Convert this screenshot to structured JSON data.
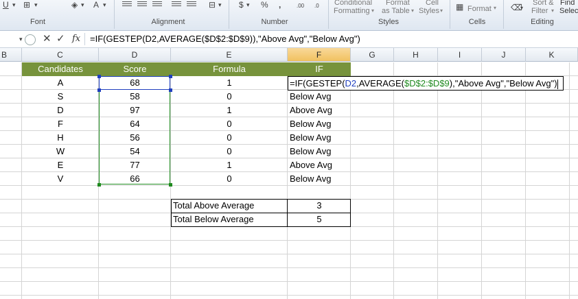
{
  "ribbon": {
    "groups": [
      "Font",
      "Alignment",
      "Number",
      "Styles",
      "Cells",
      "Editing"
    ],
    "font_underline": "U",
    "font_fill_icon": "fill-color-icon",
    "font_color_letter": "A",
    "number_currency": "$",
    "number_percent": "%",
    "number_comma": ",",
    "number_inc_decimal": ".00",
    "number_dec_decimal": ".0",
    "styles_conditional": [
      "Conditional",
      "Formatting"
    ],
    "styles_format_table": [
      "Format",
      "as Table"
    ],
    "styles_cell": [
      "Cell",
      "Styles"
    ],
    "cells_format": "Format",
    "editing_sort": [
      "Sort &",
      "Filter"
    ],
    "editing_find": [
      "Find",
      "Selec"
    ]
  },
  "formula_bar": {
    "fx": "fx",
    "formula": "=IF(GESTEP(D2,AVERAGE($D$2:$D$9)),\"Above Avg\",\"Below Avg\")"
  },
  "columns": [
    "B",
    "C",
    "D",
    "E",
    "F",
    "G",
    "H",
    "I",
    "J",
    "K"
  ],
  "table": {
    "headers": {
      "candidates": "Candidates",
      "score": "Score",
      "formula": "Formula",
      "if": "IF"
    },
    "rows": [
      {
        "candidate": "A",
        "score": "68",
        "formula": "1",
        "if": ""
      },
      {
        "candidate": "S",
        "score": "58",
        "formula": "0",
        "if": "Below Avg"
      },
      {
        "candidate": "D",
        "score": "97",
        "formula": "1",
        "if": "Above Avg"
      },
      {
        "candidate": "F",
        "score": "64",
        "formula": "0",
        "if": "Below Avg"
      },
      {
        "candidate": "H",
        "score": "56",
        "formula": "0",
        "if": "Below Avg"
      },
      {
        "candidate": "W",
        "score": "54",
        "formula": "0",
        "if": "Below Avg"
      },
      {
        "candidate": "E",
        "score": "77",
        "formula": "1",
        "if": "Above Avg"
      },
      {
        "candidate": "V",
        "score": "66",
        "formula": "0",
        "if": "Below Avg"
      }
    ]
  },
  "editing_cell": {
    "part1": "=IF(GESTEP(",
    "ref1": "D2",
    "part2": ",AVERAGE(",
    "ref2": "$D$2:$D$9",
    "part3": "),\"Above Avg\",\"Below Avg\")"
  },
  "summary": {
    "above_label": "Total Above Average",
    "above_value": "3",
    "below_label": "Total Below Average",
    "below_value": "5"
  },
  "colors": {
    "header_fill": "#77933c",
    "ref_blue": "#1f3fbf",
    "ref_green": "#1e8a1e",
    "active_column": "#f1c15f"
  }
}
